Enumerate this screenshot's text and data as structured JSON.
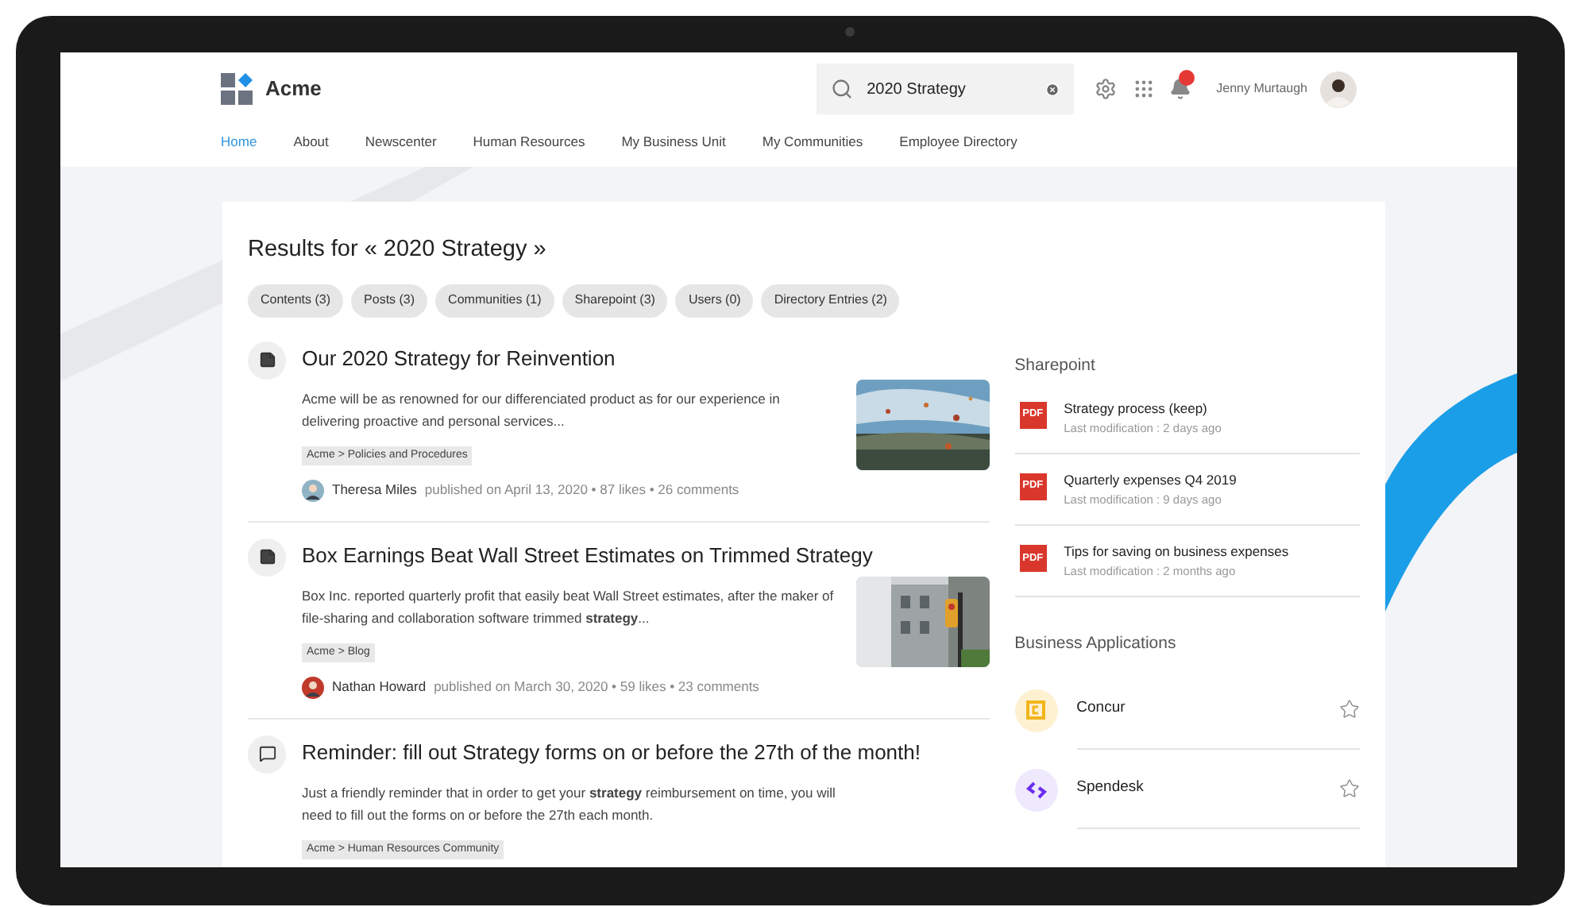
{
  "header": {
    "brand": "Acme",
    "search": {
      "value": "2020 Strategy"
    },
    "notifications": {
      "unread": true
    },
    "user": {
      "name": "Jenny Murtaugh"
    }
  },
  "nav": [
    {
      "label": "Home",
      "selected": true
    },
    {
      "label": "About",
      "selected": false
    },
    {
      "label": "Newscenter",
      "selected": false
    },
    {
      "label": "Human Resources",
      "selected": false
    },
    {
      "label": "My Business Unit",
      "selected": false
    },
    {
      "label": "My Communities",
      "selected": false
    },
    {
      "label": "Employee Directory",
      "selected": false
    }
  ],
  "results_title": "Results for « 2020 Strategy »",
  "filters": [
    "Contents (3)",
    "Posts (3)",
    "Communities (1)",
    "Sharepoint (3)",
    "Users (0)",
    "Directory Entries (2)"
  ],
  "results": [
    {
      "kind": "article",
      "title": "Our 2020 Strategy for Reinvention",
      "excerpt": "Acme will be as renowned for our differenciated product as for our experience in delivering proactive and personal services...",
      "tag": "Acme > Policies and Procedures",
      "author": "Theresa Miles",
      "meta": "published on April 13, 2020 •  87 likes • 26 comments",
      "thumbnail": true
    },
    {
      "kind": "article",
      "title": "Box Earnings Beat Wall Street Estimates on Trimmed Strategy",
      "excerpt": "Box Inc. reported quarterly profit that easily beat Wall Street estimates, after the maker of file-sharing and collaboration software trimmed **strategy**...",
      "tag": "Acme > Blog",
      "author": "Nathan Howard",
      "meta": "published on March 30, 2020 • 59 likes • 23 comments",
      "thumbnail": true
    },
    {
      "kind": "post",
      "title": "Reminder: fill out Strategy forms on or before the 27th of the month!",
      "excerpt": "Just a friendly reminder that in order to get your **strategy** reimbursement on time, you will need to fill out the forms on or before the 27th each month.",
      "tag": "Acme > Human Resources Community",
      "thumbnail": false
    }
  ],
  "sharepoint": {
    "title": "Sharepoint",
    "files": [
      {
        "type": "PDF",
        "name": "Strategy process (keep)",
        "modified": "Last modification : 2 days ago"
      },
      {
        "type": "PDF",
        "name": "Quarterly expenses Q4 2019",
        "modified": "Last modification : 9 days ago"
      },
      {
        "type": "PDF",
        "name": "Tips for saving on business expenses",
        "modified": "Last modification : 2 months ago"
      }
    ]
  },
  "applications": {
    "title": "Business Applications",
    "items": [
      {
        "kind": "concur",
        "name": "Concur",
        "favorite": false
      },
      {
        "kind": "spendesk",
        "name": "Spendesk",
        "favorite": false
      }
    ]
  }
}
